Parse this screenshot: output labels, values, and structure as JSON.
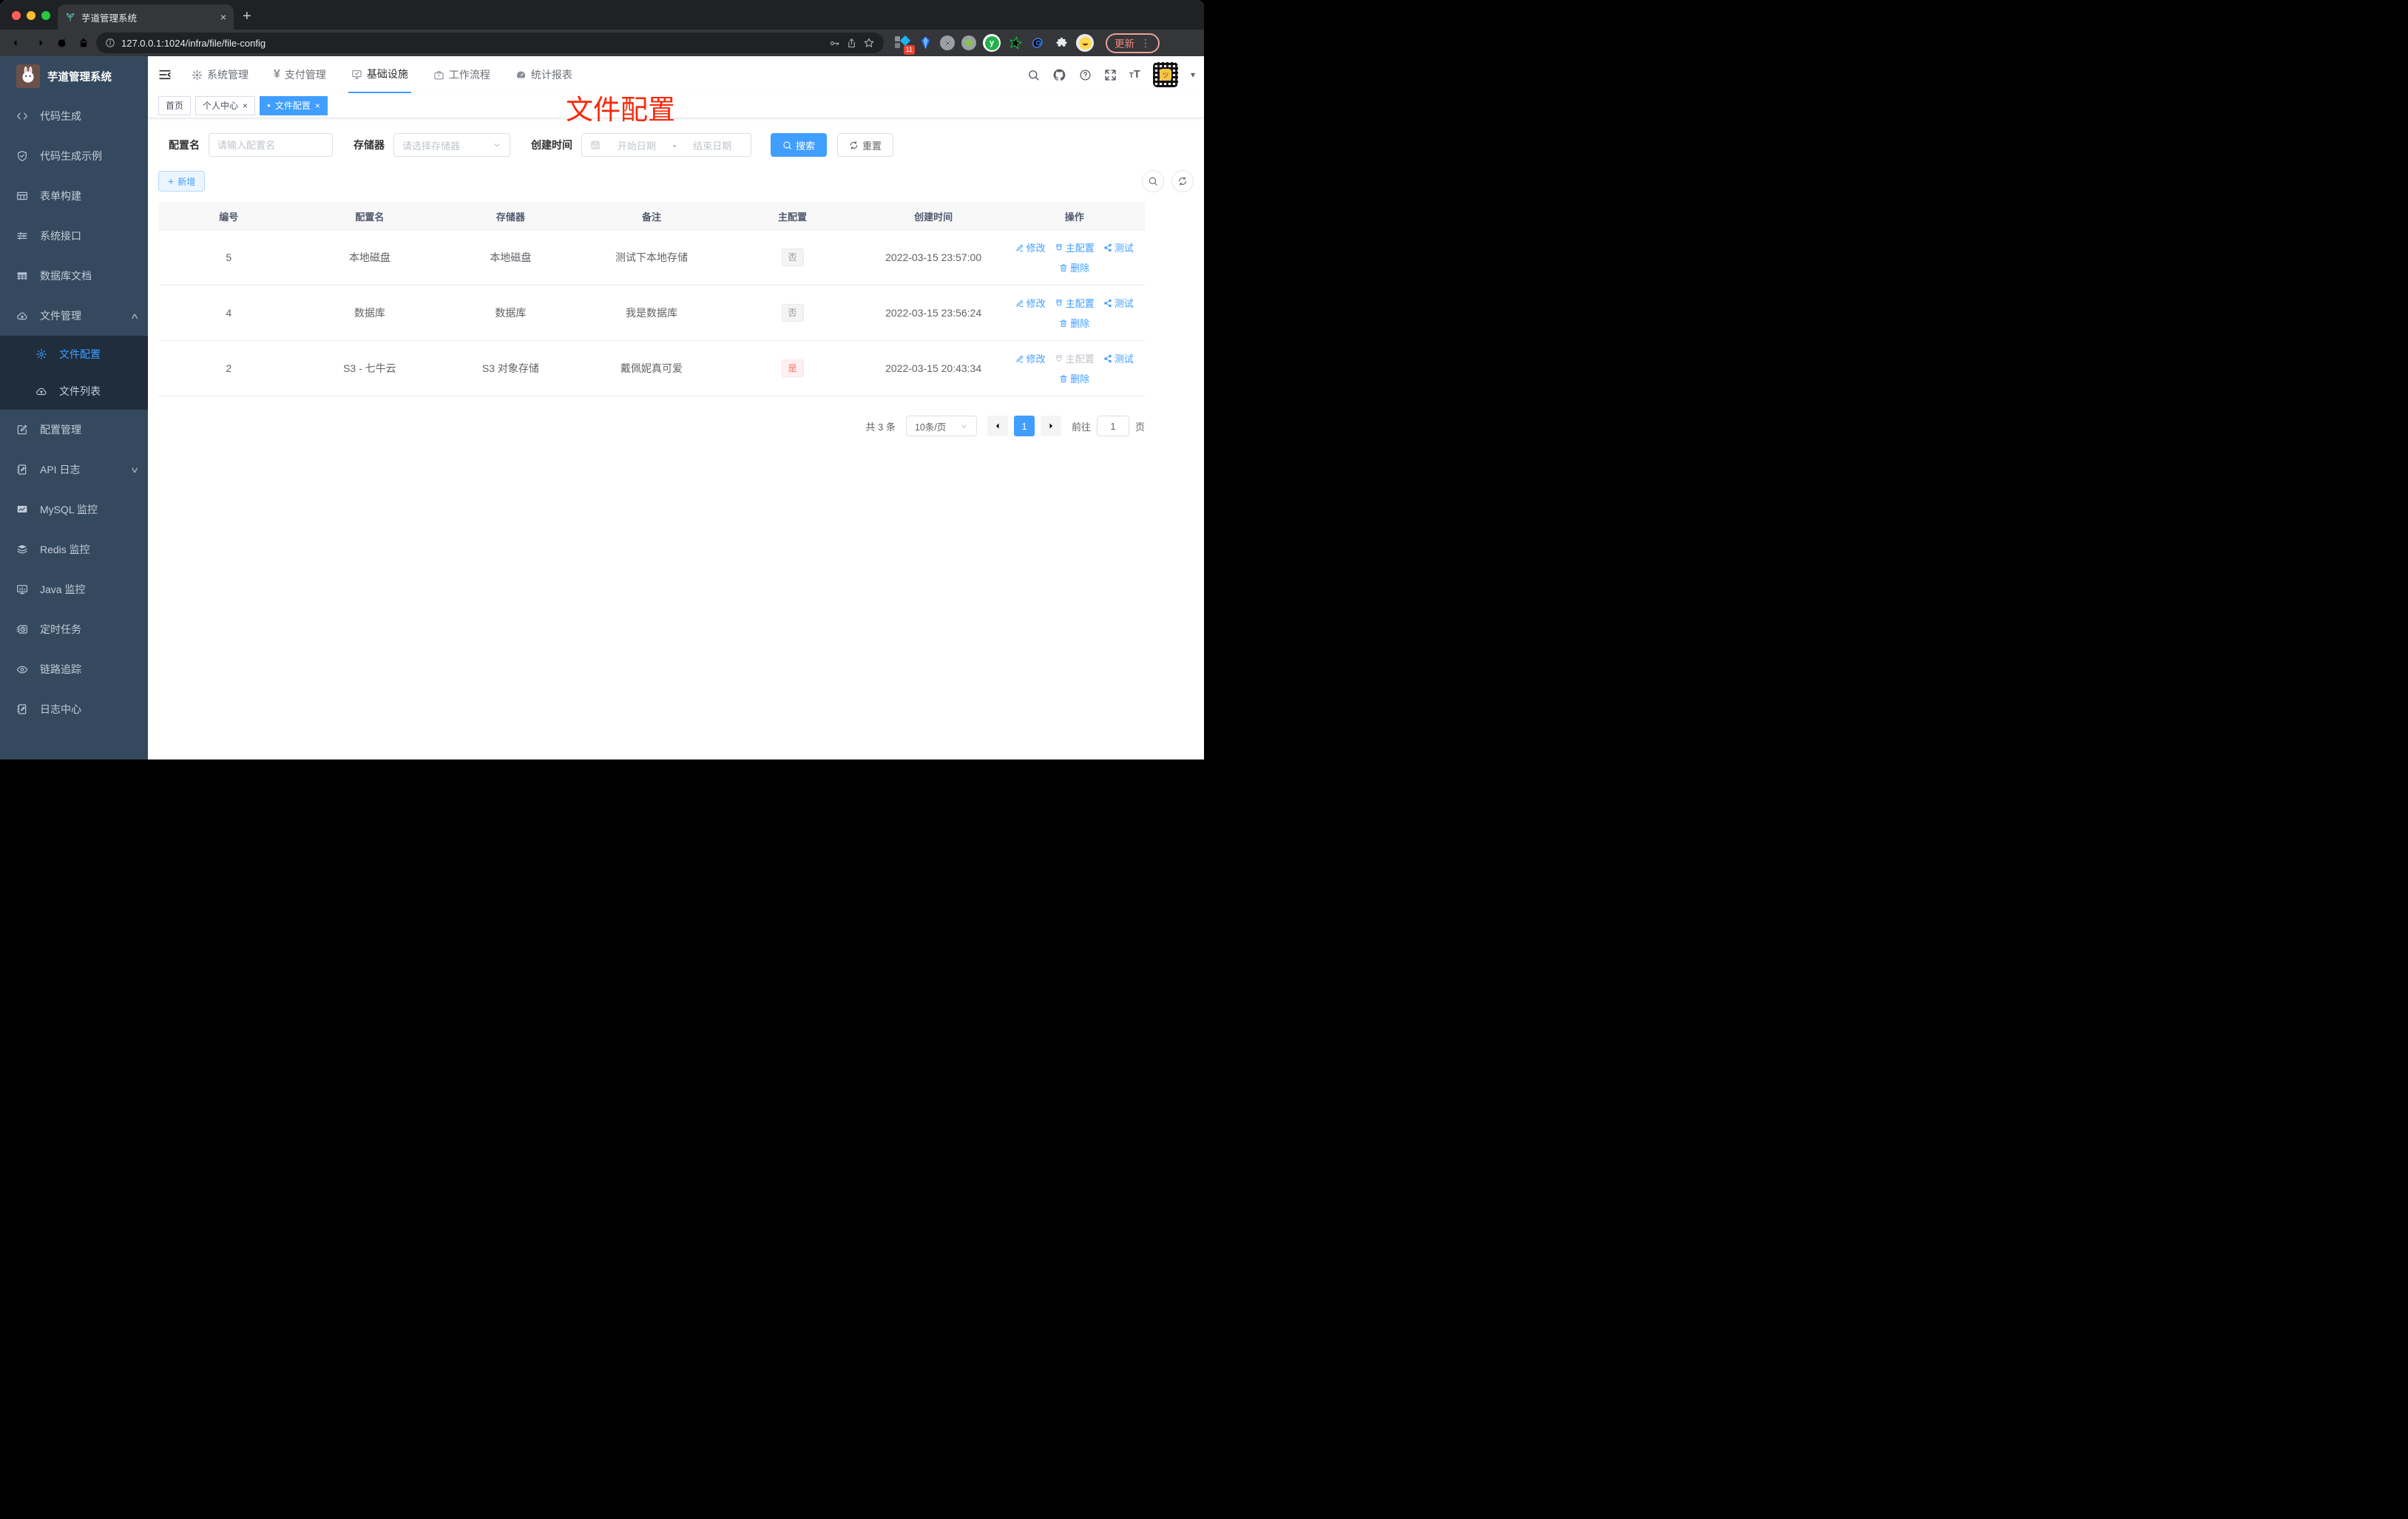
{
  "icons": {
    "close": "×",
    "caret": "▾",
    "chevron_up": "∧",
    "chevron_down": "∨",
    "plus": "+",
    "yen": "¥",
    "dot": "●",
    "dots_vertical": "⋮",
    "tt": "TT"
  },
  "browser": {
    "tab_title": "芋道管理系统",
    "url": "127.0.0.1:1024/infra/file/file-config",
    "extension_badge": "11",
    "update_label": "更新"
  },
  "sidebar": {
    "logo_title": "芋道管理系统",
    "items": [
      {
        "label": "代码生成"
      },
      {
        "label": "代码生成示例"
      },
      {
        "label": "表单构建"
      },
      {
        "label": "系统接口"
      },
      {
        "label": "数据库文档"
      },
      {
        "label": "文件管理"
      },
      {
        "label": "文件配置"
      },
      {
        "label": "文件列表"
      },
      {
        "label": "配置管理"
      },
      {
        "label": "API 日志"
      },
      {
        "label": "MySQL 监控"
      },
      {
        "label": "Redis 监控"
      },
      {
        "label": "Java 监控"
      },
      {
        "label": "定时任务"
      },
      {
        "label": "链路追踪"
      },
      {
        "label": "日志中心"
      }
    ]
  },
  "topnav": {
    "items": [
      {
        "label": "系统管理"
      },
      {
        "label": "支付管理"
      },
      {
        "label": "基础设施"
      },
      {
        "label": "工作流程"
      },
      {
        "label": "统计报表"
      }
    ]
  },
  "tags": {
    "home": "首页",
    "profile": "个人中心",
    "current": "文件配置"
  },
  "annotation": {
    "text": "文件配置",
    "color": "#F8290B"
  },
  "filters": {
    "name_label": "配置名",
    "name_placeholder": "请输入配置名",
    "storage_label": "存储器",
    "storage_placeholder": "请选择存储器",
    "date_label": "创建时间",
    "date_start_placeholder": "开始日期",
    "date_separator": "-",
    "date_end_placeholder": "结束日期",
    "search_label": "搜索",
    "reset_label": "重置"
  },
  "toolbar": {
    "add_label": "新增"
  },
  "table": {
    "columns": [
      "编号",
      "配置名",
      "存储器",
      "备注",
      "主配置",
      "创建时间",
      "操作"
    ],
    "actions": {
      "edit": "修改",
      "master": "主配置",
      "test": "测试",
      "delete": "删除"
    },
    "rows": [
      {
        "id": "5",
        "name": "本地磁盘",
        "storage": "本地磁盘",
        "remark": "测试下本地存储",
        "master": "否",
        "created": "2022-03-15 23:57:00"
      },
      {
        "id": "4",
        "name": "数据库",
        "storage": "数据库",
        "remark": "我是数据库",
        "master": "否",
        "created": "2022-03-15 23:56:24"
      },
      {
        "id": "2",
        "name": "S3 - 七牛云",
        "storage": "S3 对象存储",
        "remark": "戴佩妮真可爱",
        "master": "是",
        "created": "2022-03-15 20:43:34"
      }
    ]
  },
  "pagination": {
    "total": "共 3 条",
    "page_size": "10条/页",
    "current_page": "1",
    "goto_label": "前往",
    "goto_value": "1",
    "page_unit": "页"
  },
  "colors": {
    "accent": "#409EFF",
    "danger": "#F56C6C",
    "info": "#909399",
    "sidebar_bg": "#35495E"
  }
}
